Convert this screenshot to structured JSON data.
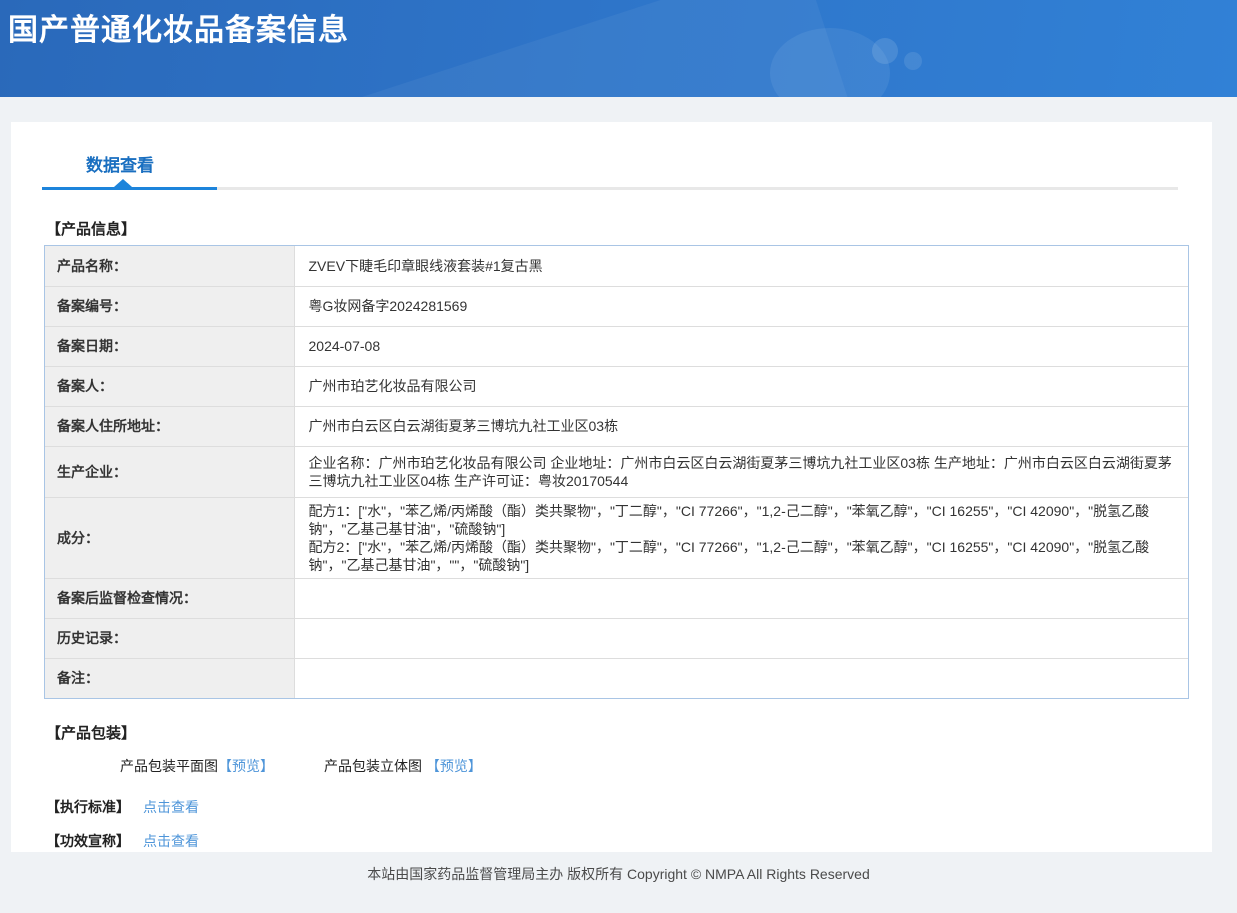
{
  "header": {
    "title": "国产普通化妆品备案信息"
  },
  "tabs": {
    "data_view": "数据查看"
  },
  "sections": {
    "product_info": "【产品信息】",
    "product_packaging": "【产品包装】",
    "execution_standard": "【执行标准】",
    "efficacy_claim": "【功效宣称】"
  },
  "product_table": {
    "rows": [
      {
        "label": "产品名称：",
        "value": "ZVEV下睫毛印章眼线液套装#1复古黑"
      },
      {
        "label": "备案编号：",
        "value": "粤G妆网备字2024281569"
      },
      {
        "label": "备案日期：",
        "value": "2024-07-08"
      },
      {
        "label": "备案人：",
        "value": "广州市珀艺化妆品有限公司"
      },
      {
        "label": "备案人住所地址：",
        "value": "广州市白云区白云湖街夏茅三博坑九社工业区03栋"
      },
      {
        "label": "生产企业：",
        "value": "企业名称：广州市珀艺化妆品有限公司 企业地址：广州市白云区白云湖街夏茅三博坑九社工业区03栋 生产地址：广州市白云区白云湖街夏茅三博坑九社工业区04栋 生产许可证：粤妆20170544"
      },
      {
        "label": "成分：",
        "value_lines": [
          "配方1：[\"水\"，\"苯乙烯/丙烯酸（酯）类共聚物\"，\"丁二醇\"，\"CI 77266\"，\"1,2-己二醇\"，\"苯氧乙醇\"，\"CI 16255\"，\"CI 42090\"，\"脱氢乙酸钠\"，\"乙基己基甘油\"，\"硫酸钠\"]",
          "配方2：[\"水\"，\"苯乙烯/丙烯酸（酯）类共聚物\"，\"丁二醇\"，\"CI 77266\"，\"1,2-己二醇\"，\"苯氧乙醇\"，\"CI 16255\"，\"CI 42090\"，\"脱氢乙酸钠\"，\"乙基己基甘油\"，\"\"，\"硫酸钠\"]"
        ]
      },
      {
        "label": "备案后监督检查情况：",
        "value": ""
      },
      {
        "label": "历史记录：",
        "value": ""
      },
      {
        "label": "备注：",
        "value": ""
      }
    ]
  },
  "packaging": {
    "flat_label": "产品包装平面图",
    "flat_link": "【预览】",
    "stereo_label": "产品包装立体图",
    "stereo_link": "【预览】"
  },
  "links": {
    "execution_standard": "点击查看",
    "efficacy_claim": "点击查看"
  },
  "footer": {
    "copyright": "本站由国家药品监督管理局主办 版权所有 Copyright © NMPA All Rights Reserved"
  },
  "colors": {
    "header_blue_start": "#2a69ba",
    "header_blue_end": "#3181d6",
    "tab_blue": "#1a6fc0",
    "tab_underline_blue": "#1d84db",
    "link_blue": "#4e95d9",
    "table_border_blue": "#a9c5e5",
    "label_cell_bg": "#efefef"
  }
}
